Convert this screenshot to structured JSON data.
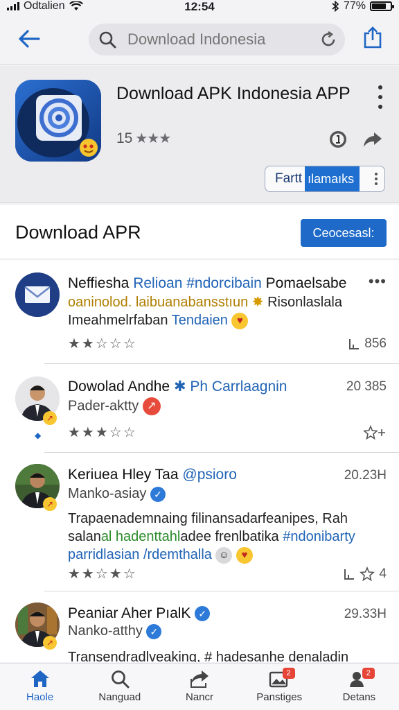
{
  "status": {
    "carrier": "Odtalien",
    "time": "12:54",
    "battery": "77%"
  },
  "search": {
    "placeholder": "Download Indonesia"
  },
  "app": {
    "title": "Download APK Indonesia APP",
    "rating_count": "15",
    "rating_stars": "★★★",
    "follow_part1": "Fartt",
    "follow_part2": "ılamaıks"
  },
  "section": {
    "title": "Download APR",
    "button": "Ceocesasl:"
  },
  "posts": [
    {
      "name": "Neffiesha",
      "tag": "Relioan #ndorcibain",
      "name_tail": "Pomaelsabe",
      "line2a": "oaninolod. laibuanabansstıun",
      "line2b": "Risonlaslala",
      "line3a": "Imeahmelrfaban",
      "line3b": "Tendaien",
      "stars": "★★☆☆☆",
      "count": "856"
    },
    {
      "name": "Dowolad Andhe",
      "tag": "Ph Carrlaagnin",
      "sub": "Pader-aktty",
      "time": "20 385",
      "stars": "★★★☆☆"
    },
    {
      "name": "Keriuea Hley Taa",
      "tag": "@psioro",
      "sub": "Manko-asiay",
      "time": "20.23H",
      "body1": "Trapaenademnaing filinansadarfeanipes, Rah",
      "body2a": "salan",
      "body2b": "al hadenttahl",
      "body2c": "adee frenlbatika",
      "body2d": "#ndonibarty",
      "body3": "parridlasian /rdemthalla",
      "stars": "★★☆★☆",
      "count": "4"
    },
    {
      "name": "Peaniar Aher PıalK",
      "sub": "Nanko-atthy",
      "time": "29.33H",
      "body1a": "Transendradlveaking,",
      "body1b": "# hadesanhe denaladin"
    }
  ],
  "tabs": [
    {
      "label": "Haole",
      "icon": "home-icon"
    },
    {
      "label": "Nanguad",
      "icon": "search-icon"
    },
    {
      "label": "Nancr",
      "icon": "share-icon"
    },
    {
      "label": "Panstiges",
      "icon": "image-icon",
      "badge": "2"
    },
    {
      "label": "Detans",
      "icon": "profile-icon",
      "badge": "2"
    }
  ],
  "colors": {
    "accent": "#1f6ac9",
    "tag": "#2063b5",
    "badge": "#e64436"
  }
}
